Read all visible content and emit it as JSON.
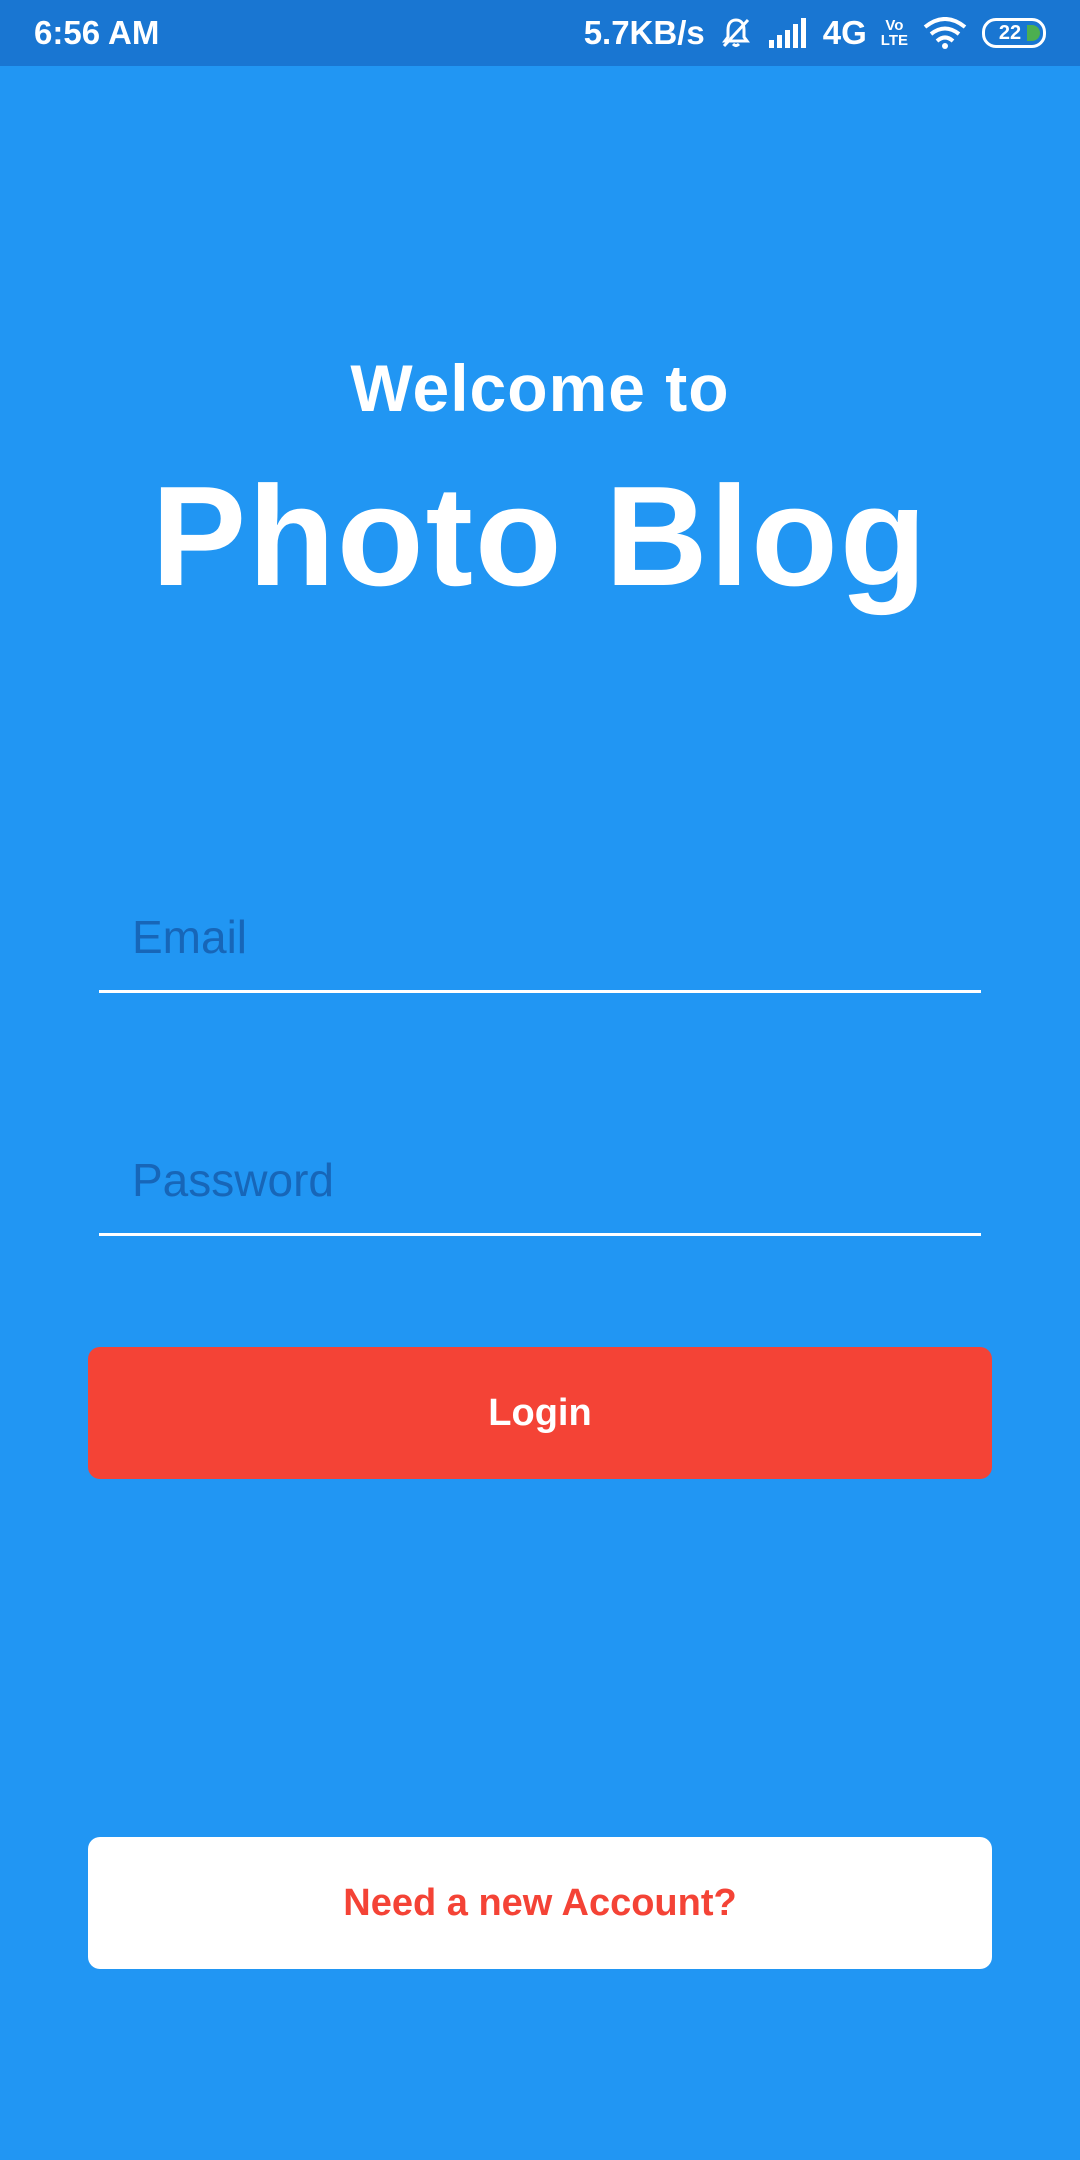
{
  "status_bar": {
    "time": "6:56 AM",
    "network_speed": "5.7KB/s",
    "network_type": "4G",
    "volte_top": "Vo",
    "volte_bottom": "LTE",
    "battery_level": "22",
    "icons": [
      "mute-bell-icon",
      "signal-icon",
      "wifi-icon",
      "battery-icon"
    ]
  },
  "header": {
    "welcome": "Welcome to",
    "brand": "Photo Blog"
  },
  "form": {
    "email_placeholder": "Email",
    "password_placeholder": "Password",
    "login_label": "Login",
    "signup_label": "Need a new Account?"
  },
  "colors": {
    "background": "#2196F3",
    "status_bar": "#1976D2",
    "accent": "#F44336",
    "text": "#FFFFFF"
  }
}
